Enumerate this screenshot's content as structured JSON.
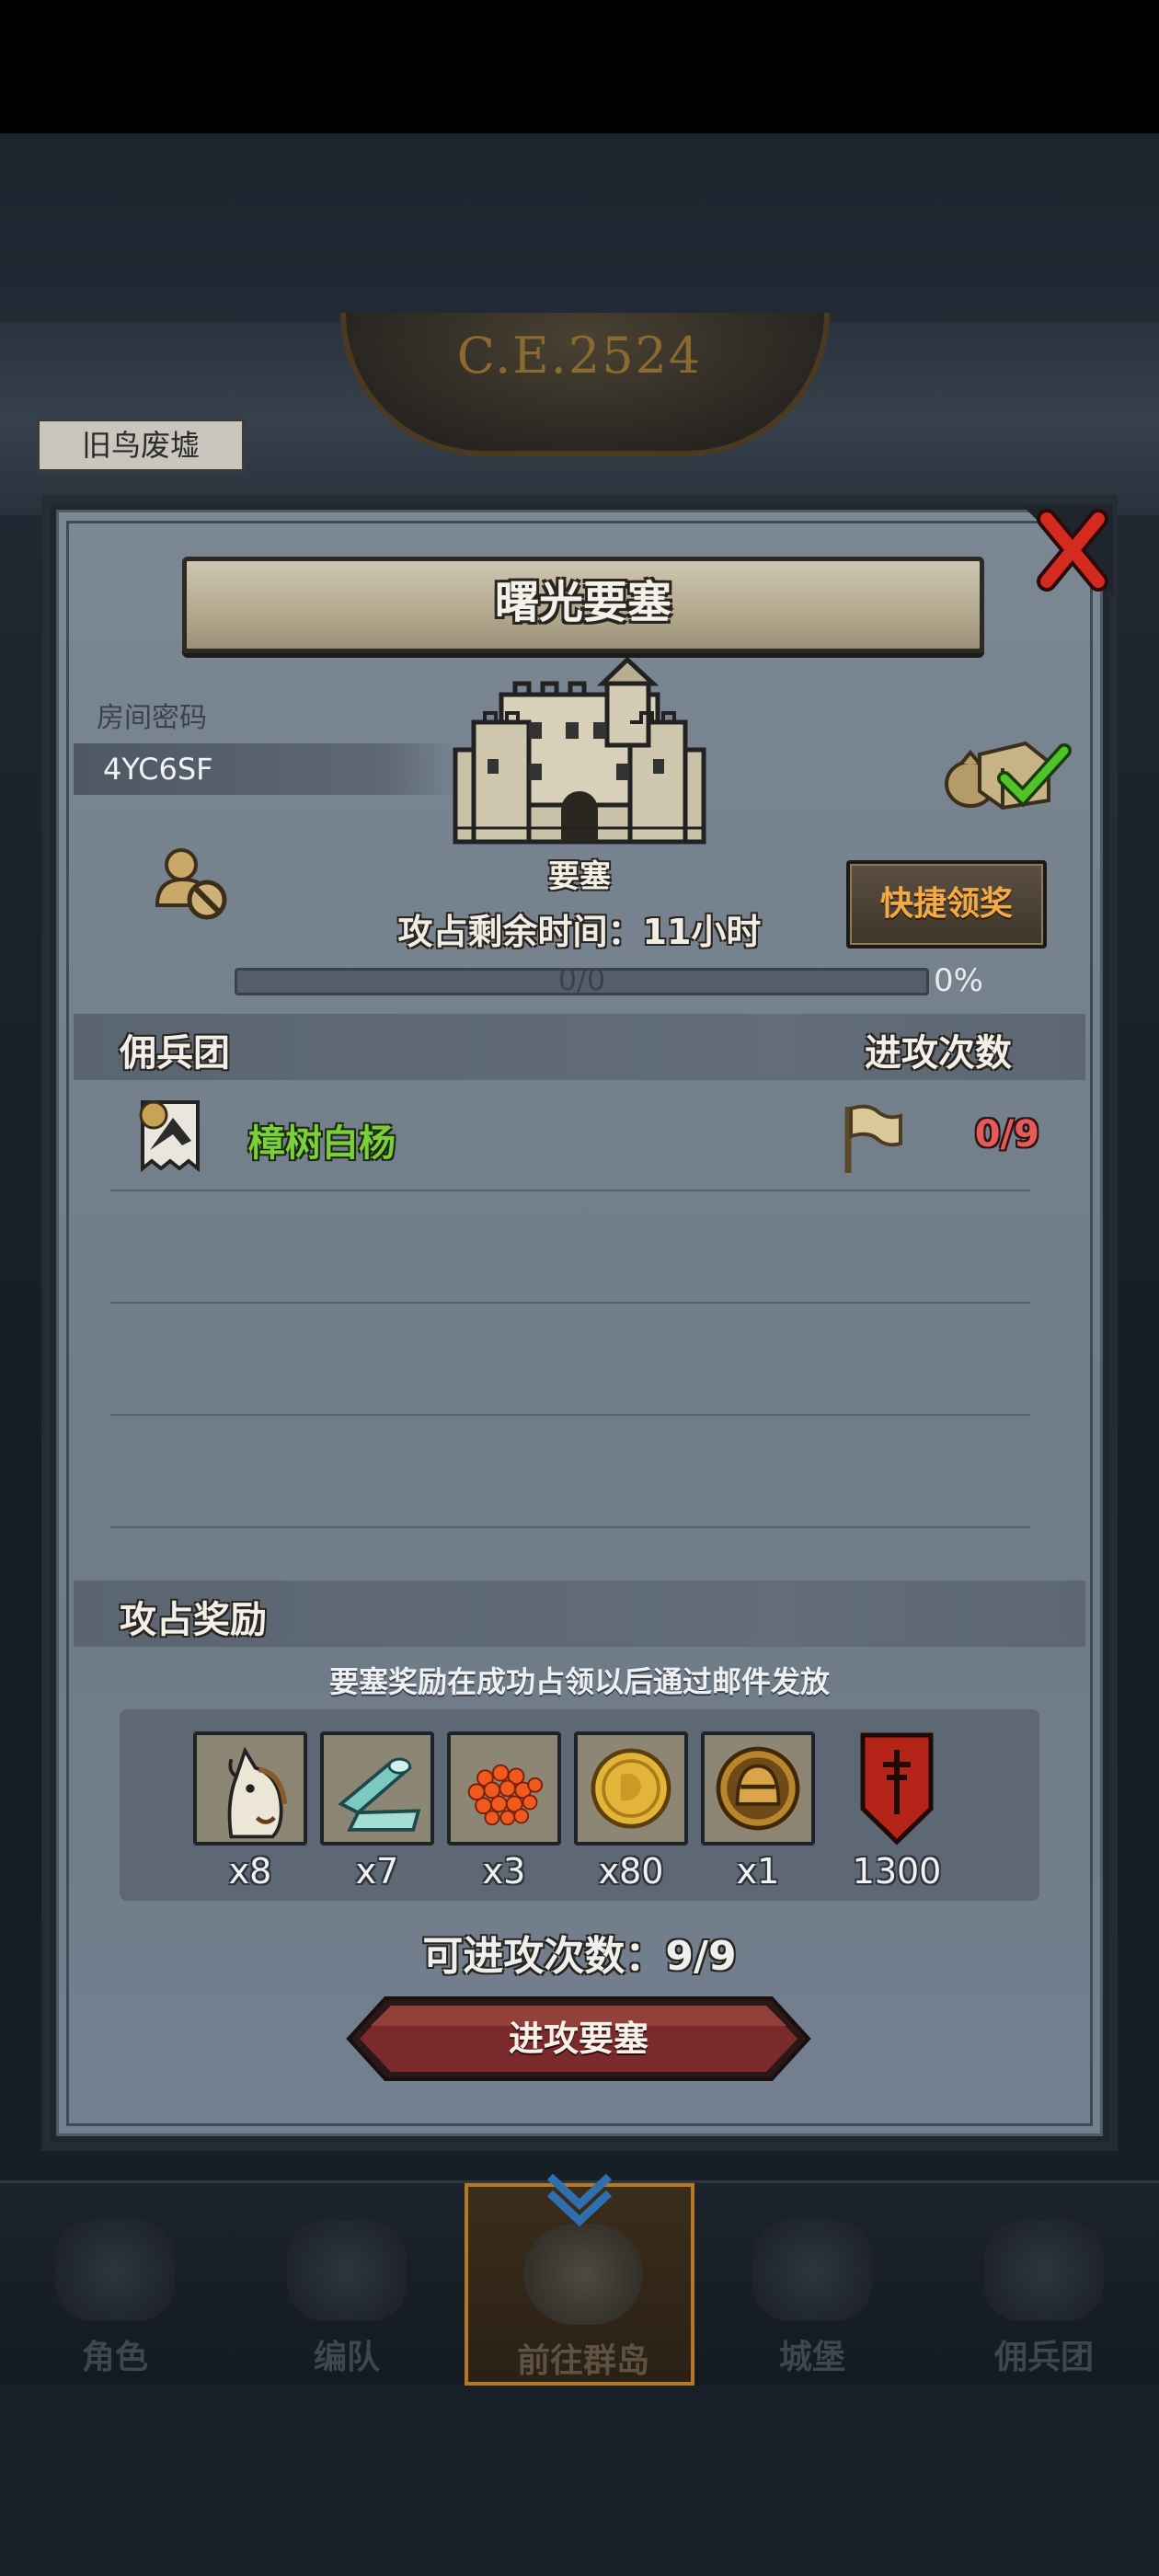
{
  "background": {
    "era_label": "C.E.2524",
    "location_label": "旧鸟废墟"
  },
  "dialog": {
    "title": "曙光要塞",
    "room_code_label": "房间密码",
    "room_code": "4YC6SF",
    "building_label": "要塞",
    "quick_claim_label": "快捷领奖",
    "remaining_time": "攻占剩余时间：11小时",
    "progress": {
      "text": "0/0",
      "percent_text": "0%",
      "fraction": 0.0
    },
    "mercenary_header": "佣兵团",
    "attacks_header": "进攻次数",
    "mercenaries": [
      {
        "name": "樟树白杨",
        "attacks": "0/9"
      }
    ],
    "reward_header": "攻占奖励",
    "reward_note": "要塞奖励在成功占领以后通过邮件发放",
    "rewards": [
      {
        "icon": "horse-icon",
        "qty": "x8"
      },
      {
        "icon": "cloth-roll-icon",
        "qty": "x7"
      },
      {
        "icon": "red-beads-icon",
        "qty": "x3"
      },
      {
        "icon": "gold-coin-icon",
        "qty": "x80"
      },
      {
        "icon": "knight-helmet-medal-icon",
        "qty": "x1"
      },
      {
        "icon": "red-banner-icon",
        "qty": "1300"
      }
    ],
    "attacks_available": "可进攻次数：9/9",
    "attack_button_label": "进攻要塞"
  },
  "bottom_nav": [
    {
      "label": "角色",
      "icon": "knight-icon"
    },
    {
      "label": "编队",
      "icon": "formation-icon"
    },
    {
      "label": "前往群岛",
      "icon": "globe-icon",
      "active": true
    },
    {
      "label": "城堡",
      "icon": "castle-icon"
    },
    {
      "label": "佣兵团",
      "icon": "mercenary-icon"
    }
  ],
  "colors": {
    "accent_orange": "#f4a944",
    "merc_green": "#7bcf3c",
    "count_red": "#e85a5a",
    "attack_button": "#7a2a2a"
  }
}
